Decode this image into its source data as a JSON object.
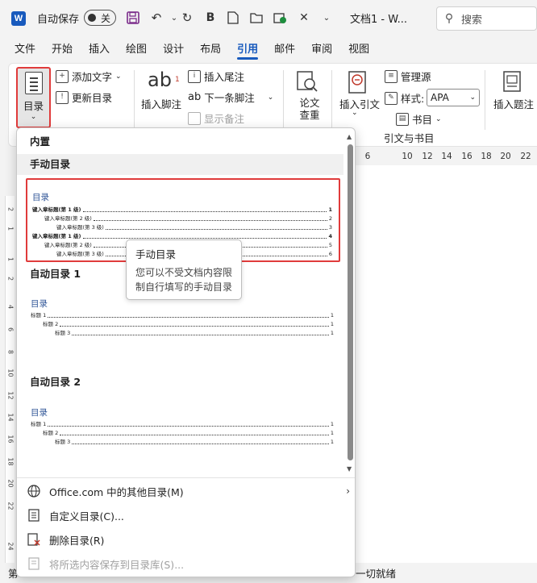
{
  "titlebar": {
    "app_icon": "W",
    "autosave_label": "自动保存",
    "autosave_state": "关",
    "doc_title": "文档1  -  W...",
    "search_placeholder": "搜索",
    "quick_access_icons": [
      "save-icon",
      "undo-icon",
      "redo-icon",
      "bold-icon",
      "new-doc-icon",
      "open-icon",
      "check-icon",
      "close-icon",
      "customize-icon"
    ]
  },
  "tabs": [
    "文件",
    "开始",
    "插入",
    "绘图",
    "设计",
    "布局",
    "引用",
    "邮件",
    "审阅",
    "视图"
  ],
  "active_tab": "引用",
  "ribbon": {
    "toc_label": "目录",
    "add_text": "添加文字",
    "update_toc": "更新目录",
    "insert_footnote": "插入脚注",
    "insert_endnote": "插入尾注",
    "next_footnote": "下一条脚注",
    "show_notes": "显示备注",
    "research": "论文查重",
    "insert_citation": "插入引文",
    "manage_sources": "管理源",
    "style_label": "样式:",
    "style_value": "APA",
    "bibliography": "书目",
    "group_citations": "引文与书目",
    "insert_caption": "插入题注"
  },
  "ruler_numbers": [
    "6",
    "10",
    "12",
    "14",
    "16",
    "18",
    "20",
    "22"
  ],
  "ruler_left_numbers": [
    "2",
    "1",
    "1",
    "2",
    "4",
    "6",
    "8",
    "10",
    "12",
    "14",
    "16",
    "18",
    "20",
    "22",
    "24"
  ],
  "status": {
    "left": "第",
    "right": "一切就绪"
  },
  "dropdown": {
    "section_builtin": "内置",
    "manual": {
      "header": "手动目录",
      "preview_title": "目录",
      "rows": [
        {
          "text": "键入章标题(第 1 级)",
          "page": "1",
          "level": 1
        },
        {
          "text": "键入章标题(第 2 级)",
          "page": "2",
          "level": 2
        },
        {
          "text": "键入章标题(第 3 级)",
          "page": "3",
          "level": 3
        },
        {
          "text": "键入章标题(第 1 级)",
          "page": "4",
          "level": 1
        },
        {
          "text": "键入章标题(第 2 级)",
          "page": "5",
          "level": 2
        },
        {
          "text": "键入章标题(第 3 级)",
          "page": "6",
          "level": 3
        }
      ]
    },
    "auto1": {
      "header": "自动目录 1",
      "preview_title": "目录",
      "rows": [
        {
          "text": "标题 1",
          "page": "1",
          "level": 1
        },
        {
          "text": "标题 2",
          "page": "1",
          "level": 2
        },
        {
          "text": "标题 3",
          "page": "1",
          "level": 3
        }
      ]
    },
    "auto2": {
      "header": "自动目录 2",
      "preview_title": "目录",
      "rows": [
        {
          "text": "标题 1",
          "page": "1",
          "level": 1
        },
        {
          "text": "标题 2",
          "page": "1",
          "level": 2
        },
        {
          "text": "标题 3",
          "page": "1",
          "level": 3
        }
      ]
    },
    "menu": {
      "more_from_office": "Office.com 中的其他目录(M)",
      "custom_toc": "自定义目录(C)...",
      "remove_toc": "删除目录(R)",
      "save_selection": "将所选内容保存到目录库(S)..."
    }
  },
  "tooltip": {
    "title": "手动目录",
    "description": "您可以不受文档内容限制自行填写的手动目录"
  },
  "colors": {
    "accent": "#185abd",
    "highlight": "#e03b3b",
    "preview_title": "#2f5597"
  }
}
